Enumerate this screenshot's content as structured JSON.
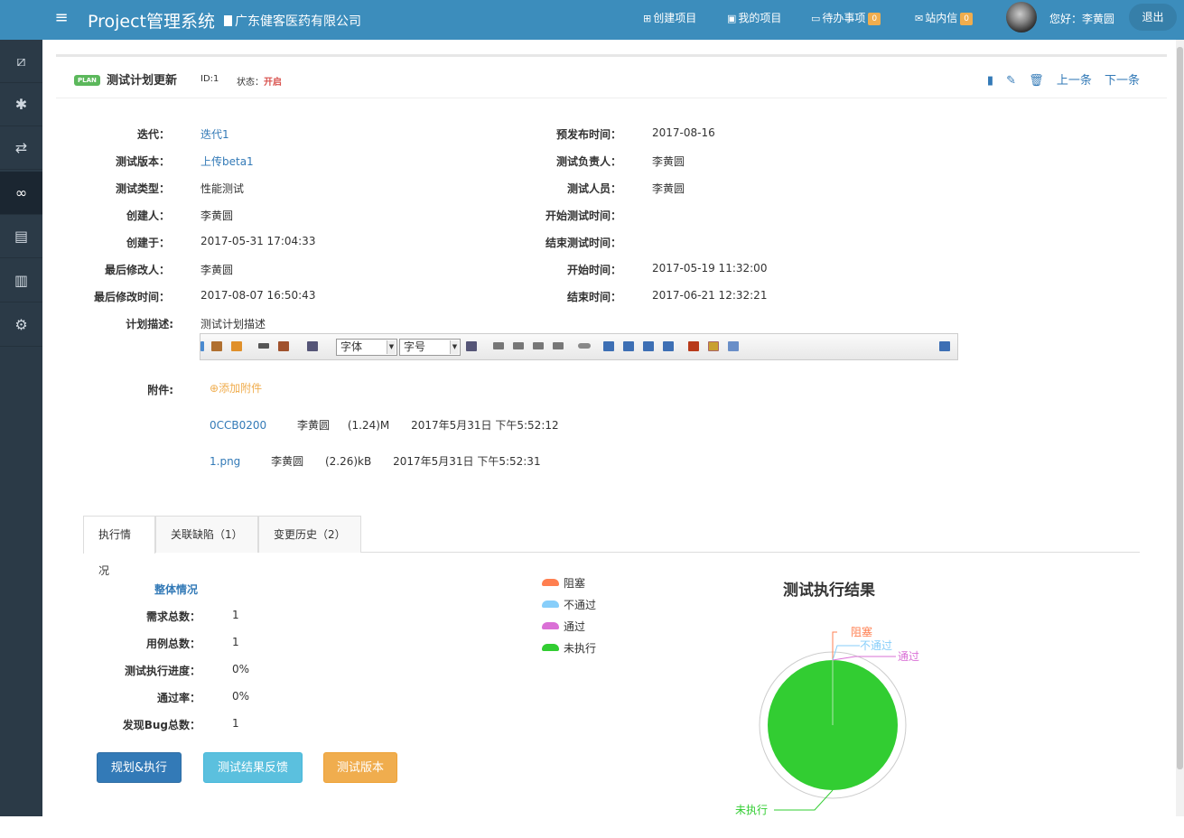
{
  "topbar": {
    "app_title": "Project管理系统",
    "company": "广东健客医药有限公司",
    "nav": {
      "create_project": "创建项目",
      "my_projects": "我的项目",
      "todo": "待办事项",
      "todo_count": "0",
      "messages": "站内信",
      "messages_count": "0"
    },
    "greeting": "您好：李黄圆",
    "logout": "退出"
  },
  "sidebar": {
    "items": [
      "dashboard-icon",
      "bug-icon",
      "exchange-icon",
      "link-icon",
      "list-icon",
      "bar-chart-icon",
      "settings-icon"
    ],
    "active_index": 3
  },
  "plan": {
    "badge": "PLAN",
    "title": "测试计划更新",
    "id_label": "ID:1",
    "status_label": "状态：",
    "status_value": "开启",
    "prev": "上一条",
    "next": "下一条"
  },
  "fields": {
    "iteration_label": "迭代：",
    "iteration_value": "迭代1",
    "version_label": "测试版本：",
    "version_value": "上传beta1",
    "type_label": "测试类型：",
    "type_value": "性能测试",
    "creator_label": "创建人：",
    "creator_value": "李黄圆",
    "created_label": "创建于：",
    "created_value": "2017-05-31 17:04:33",
    "modifier_label": "最后修改人：",
    "modifier_value": "李黄圆",
    "modified_label": "最后修改时间：",
    "modified_value": "2017-08-07 16:50:43",
    "desc_label": "计划描述:",
    "desc_value": "测试计划描述",
    "release_label": "预发布时间：",
    "release_value": "2017-08-16",
    "owner_label": "测试负责人：",
    "owner_value": "李黄圆",
    "tester_label": "测试人员：",
    "tester_value": "李黄圆",
    "test_start_label": "开始测试时间：",
    "test_end_label": "结束测试时间：",
    "start_label": "开始时间：",
    "start_value": "2017-05-19 11:32:00",
    "end_label": "结束时间：",
    "end_value": "2017-06-21 12:32:21"
  },
  "editor": {
    "font_select": "字体",
    "size_select": "字号"
  },
  "attachments": {
    "label": "附件:",
    "add": "添加附件",
    "files": [
      {
        "name": "0CCB0200",
        "user": "李黄圆",
        "size": "(1.24)M",
        "time": "2017年5月31日 下午5:52:12"
      },
      {
        "name": "1.png",
        "user": "李黄圆",
        "size": "(2.26)kB",
        "time": "2017年5月31日 下午5:52:31"
      }
    ]
  },
  "tabs": [
    "执行情况",
    "关联缺陷（1）",
    "变更历史（2）"
  ],
  "summary": {
    "title": "整体情况",
    "rows": [
      {
        "label": "需求总数：",
        "value": "1"
      },
      {
        "label": "用例总数：",
        "value": "1"
      },
      {
        "label": "测试执行进度：",
        "value": "0%"
      },
      {
        "label": "通过率：",
        "value": "0%"
      },
      {
        "label": "发现Bug总数：",
        "value": "1"
      }
    ]
  },
  "buttons": {
    "plan_execute": "规划&执行",
    "feedback": "测试结果反馈",
    "test_version": "测试版本"
  },
  "colors": {
    "primary": "#3c8dbc",
    "sidebar": "#2b3a47",
    "btn_primary": "#337ab7",
    "btn_info": "#5bc0de",
    "btn_warning": "#f0ad4e"
  },
  "chart_data": {
    "type": "pie",
    "title": "测试执行结果",
    "legend_position": "left",
    "categories": [
      "阻塞",
      "不通过",
      "通过",
      "未执行"
    ],
    "values": [
      0,
      0,
      0,
      1
    ],
    "colors": [
      "#ff7f50",
      "#87cefa",
      "#da70d6",
      "#32cd32"
    ]
  }
}
